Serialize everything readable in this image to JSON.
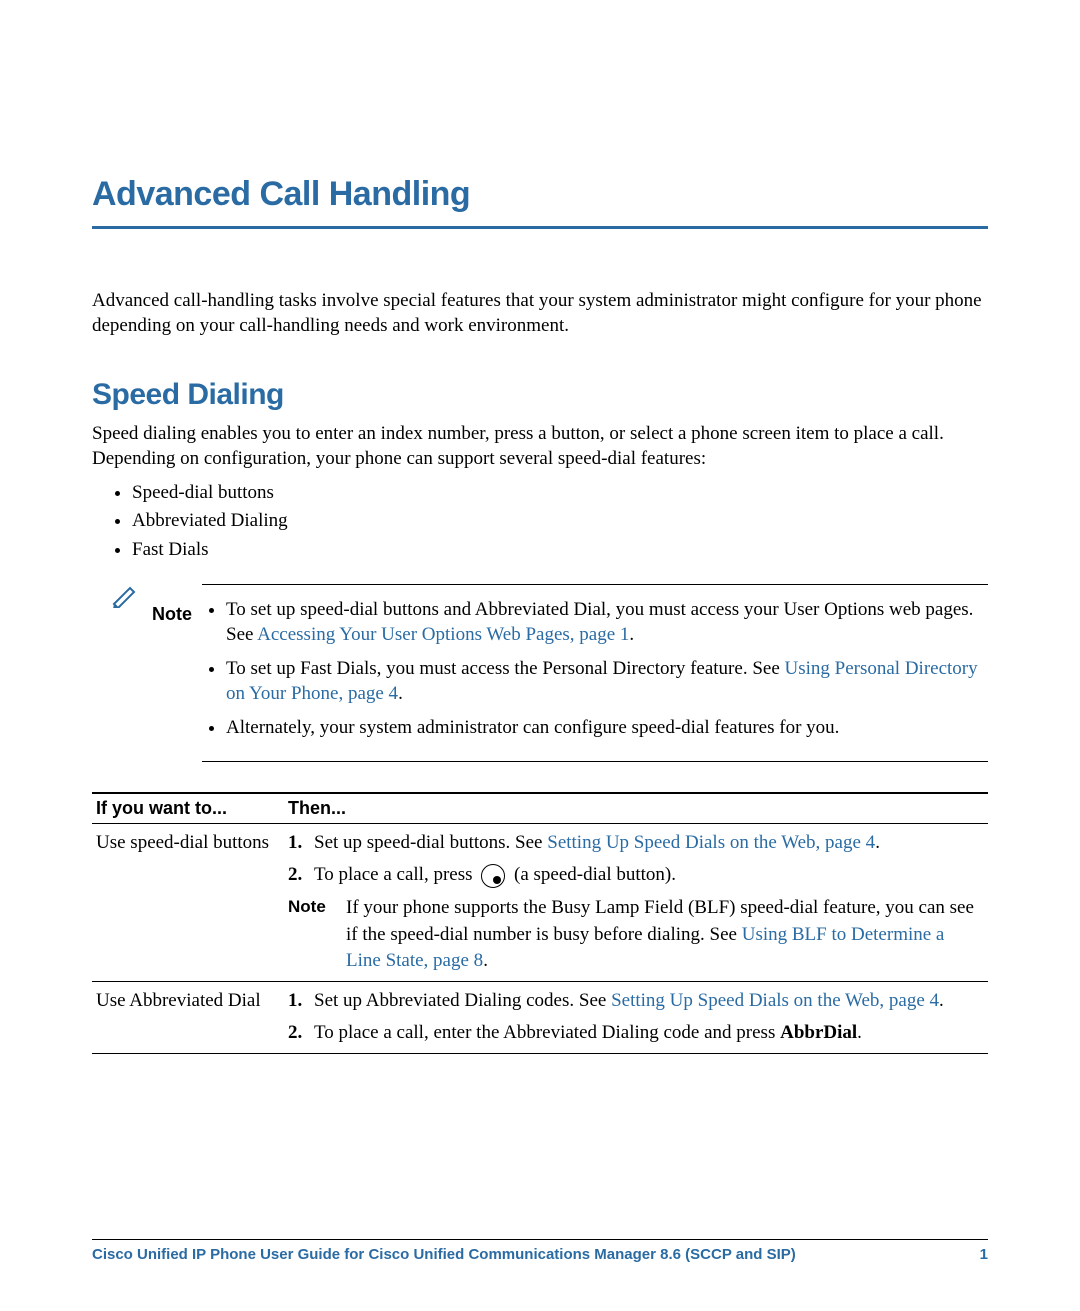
{
  "chapter_title": "Advanced Call Handling",
  "intro": "Advanced call-handling tasks involve special features that your system administrator might configure for your phone depending on your call-handling needs and work environment.",
  "section_title": "Speed Dialing",
  "section_intro": "Speed dialing enables you to enter an index number, press a button, or select a phone screen item to place a call. Depending on configuration, your phone can support several speed-dial features:",
  "features": [
    "Speed-dial buttons",
    "Abbreviated Dialing",
    "Fast Dials"
  ],
  "note_label": "Note",
  "note_items": {
    "i1a": "To set up speed-dial buttons and Abbreviated Dial, you must access your User Options web pages. See ",
    "i1_link": "Accessing Your User Options Web Pages, page 1",
    "i1b": ".",
    "i2a": "To set up Fast Dials, you must access the Personal Directory feature. See ",
    "i2_link": "Using Personal Directory on Your Phone, page 4",
    "i2b": ".",
    "i3": "Alternately, your system administrator can configure speed-dial features for you."
  },
  "table": {
    "h1": "If you want to...",
    "h2": "Then...",
    "r1c1": "Use speed-dial buttons",
    "r1": {
      "s1a": "Set up speed-dial buttons. See ",
      "s1_link": "Setting Up Speed Dials on the Web, page 4",
      "s1b": ".",
      "s2a": "To place a call, press ",
      "s2b": " (a speed-dial button).",
      "note_label": "Note",
      "note_a": "If your phone supports the Busy Lamp Field (BLF) speed-dial feature, you can see if the speed-dial number is busy before dialing. See ",
      "note_link": "Using BLF to Determine a Line State, page 8",
      "note_b": "."
    },
    "r2c1": "Use Abbreviated Dial",
    "r2": {
      "s1a": "Set up Abbreviated Dialing codes. See ",
      "s1_link": "Setting Up Speed Dials on the Web, page 4",
      "s1b": ".",
      "s2a": "To place a call, enter the Abbreviated Dialing code and press ",
      "s2_bold": "AbbrDial",
      "s2b": "."
    }
  },
  "footer_title": "Cisco Unified IP Phone User Guide for Cisco Unified Communications Manager 8.6 (SCCP and SIP)",
  "footer_page": "1"
}
